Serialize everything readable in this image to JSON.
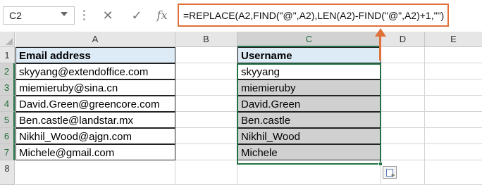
{
  "formula_bar": {
    "name_box": "C2",
    "cancel_icon": "✕",
    "enter_icon": "✓",
    "fx_label": "fx",
    "formula": "=REPLACE(A2,FIND(\"@\",A2),LEN(A2)-FIND(\"@\",A2)+1,\"\")"
  },
  "columns": [
    "A",
    "B",
    "C",
    "D",
    "E"
  ],
  "rows": [
    "1",
    "2",
    "3",
    "4",
    "5",
    "6",
    "7",
    "8"
  ],
  "sheet": {
    "a_header": "Email address",
    "c_header": "Username",
    "emails": [
      "skyyang@extendoffice.com",
      "miemieruby@sina.cn",
      "David.Green@greencore.com",
      "Ben.castle@landstar.mx",
      "Nikhil_Wood@ajgn.com",
      "Michele@gmail.com"
    ],
    "usernames": [
      "skyyang",
      "miemieruby",
      "David.Green",
      "Ben.castle",
      "Nikhil_Wood",
      "Michele"
    ]
  },
  "colors": {
    "accent_arrow": "#e0703a",
    "selection": "#217346",
    "header_fill": "#ddebf7",
    "result_fill": "#d0d0d0"
  }
}
